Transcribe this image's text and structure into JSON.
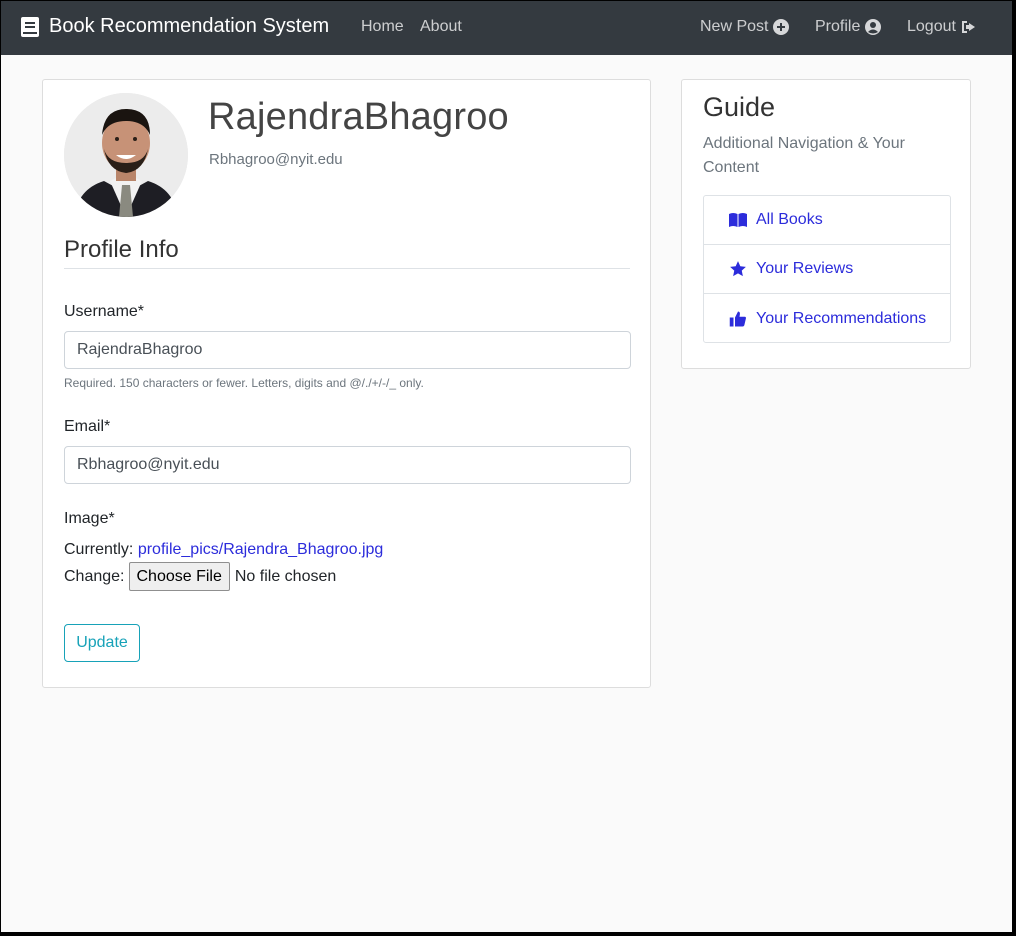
{
  "navbar": {
    "brand": "Book Recommendation System",
    "links": {
      "home": "Home",
      "about": "About",
      "new_post": "New Post",
      "profile": "Profile",
      "logout": "Logout"
    }
  },
  "profile": {
    "username": "RajendraBhagroo",
    "email": "Rbhagroo@nyit.edu"
  },
  "form": {
    "legend": "Profile Info",
    "username_label": "Username*",
    "username_value": "RajendraBhagroo",
    "username_help": "Required. 150 characters or fewer. Letters, digits and @/./+/-/_ only.",
    "email_label": "Email*",
    "email_value": "Rbhagroo@nyit.edu",
    "image_label": "Image*",
    "currently_label": "Currently:",
    "current_file": "profile_pics/Rajendra_Bhagroo.jpg",
    "change_label": "Change:",
    "choose_file": "Choose File",
    "file_status": "No file chosen",
    "submit": "Update"
  },
  "sidebar": {
    "title": "Guide",
    "subtitle": "Additional Navigation & Your Content",
    "items": [
      {
        "label": "All Books",
        "icon": "book-open-icon"
      },
      {
        "label": "Your Reviews",
        "icon": "star-icon"
      },
      {
        "label": "Your Recommendations",
        "icon": "thumbs-up-icon"
      }
    ]
  },
  "colors": {
    "navbar": "#343a40",
    "link": "#2c2cdb",
    "update_button": "#17a2b8"
  }
}
